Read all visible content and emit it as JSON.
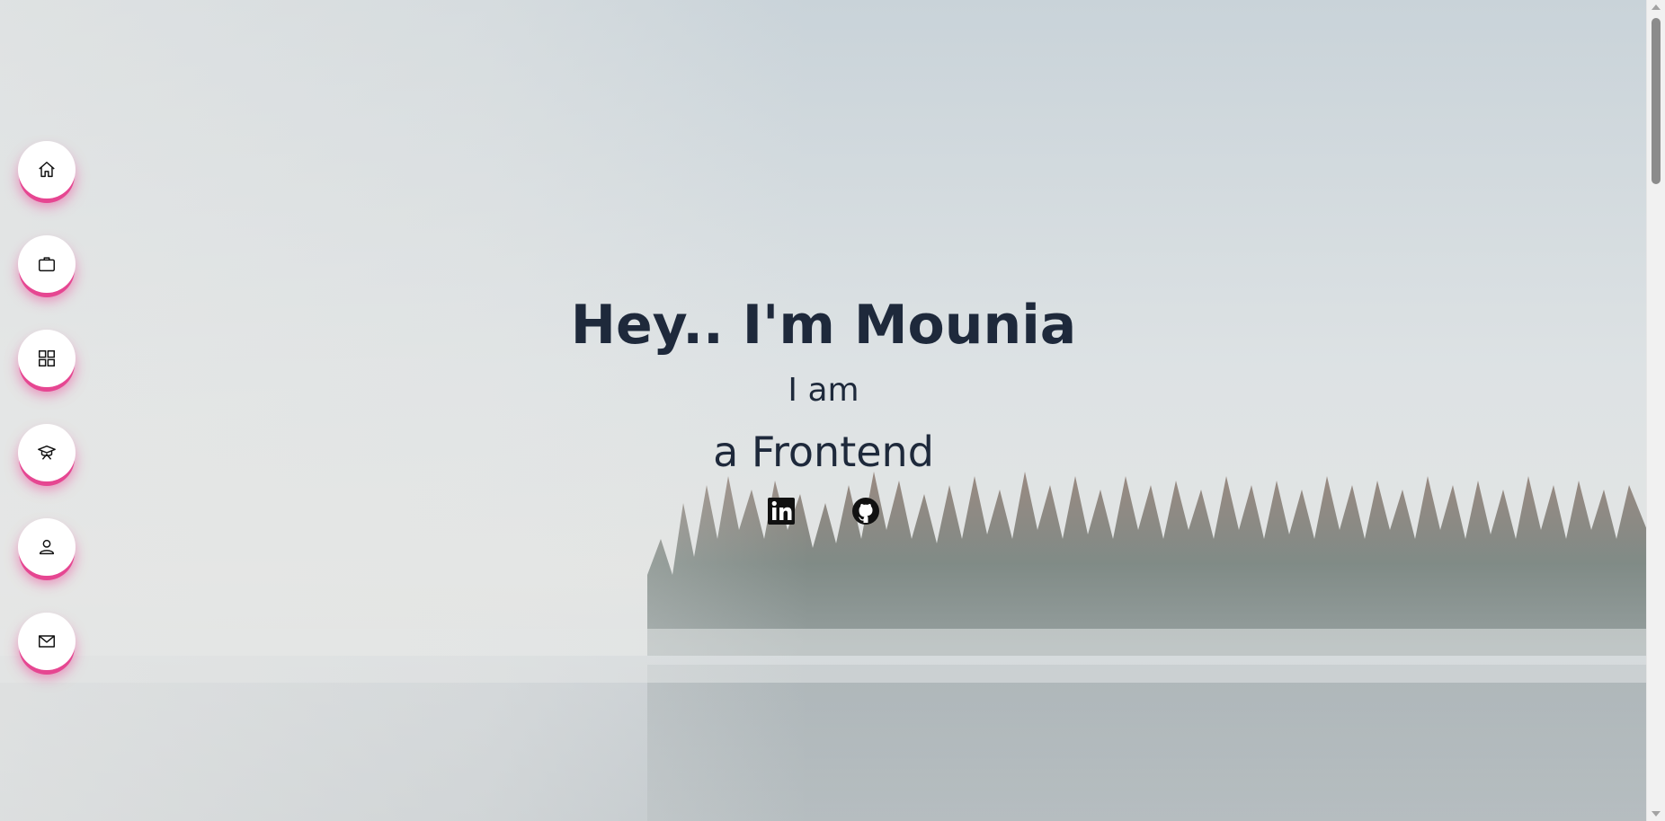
{
  "hero": {
    "title": "Hey.. I'm Mounia",
    "subtitle": "I am",
    "role": "a Frontend"
  },
  "nav": {
    "items": [
      {
        "icon": "home-icon"
      },
      {
        "icon": "briefcase-icon"
      },
      {
        "icon": "grid-icon"
      },
      {
        "icon": "graduation-icon"
      },
      {
        "icon": "user-icon"
      },
      {
        "icon": "mail-icon"
      }
    ]
  },
  "socials": [
    {
      "icon": "linkedin-icon"
    },
    {
      "icon": "github-icon"
    }
  ],
  "colors": {
    "text": "#1e293b",
    "accent_shadow": "#ec4899",
    "button_bg": "#ffffff"
  }
}
